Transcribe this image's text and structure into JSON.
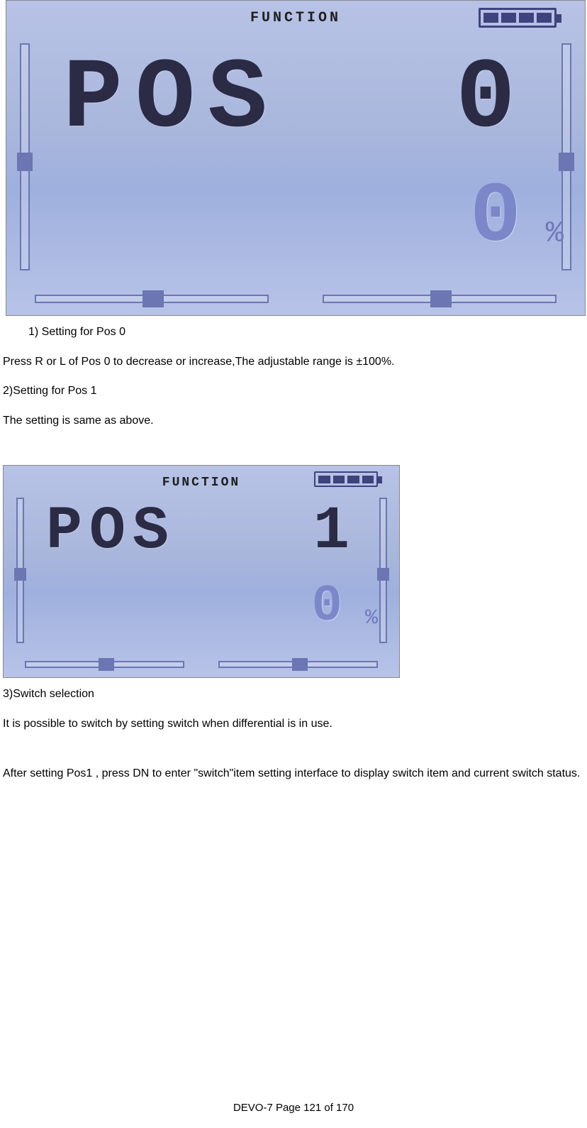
{
  "lcd1": {
    "header": "FUNCTION",
    "battery_cells": 4,
    "main_label": "POS",
    "main_value": "0",
    "sub_value": "0",
    "percent": "%"
  },
  "lcd2": {
    "header": "FUNCTION",
    "battery_cells": 4,
    "main_label": "POS",
    "main_value": "1",
    "sub_value": "0",
    "percent": "%"
  },
  "text": {
    "step1_title": "1)    Setting for Pos 0",
    "step1_body": "Press R or L of Pos 0 to decrease or increase,The adjustable range is ±100%.",
    "step2_title": "2)Setting for Pos 1",
    "step2_body": "The setting is same as above.",
    "step3_title": "3)Switch selection",
    "step3_body": "It is possible to switch by setting switch when differential is in use.",
    "step3_body2": " After setting Pos1 , press DN to enter \"switch\"item setting interface to display switch item and current switch status."
  },
  "footer": "DEVO-7     Page 121 of 170"
}
